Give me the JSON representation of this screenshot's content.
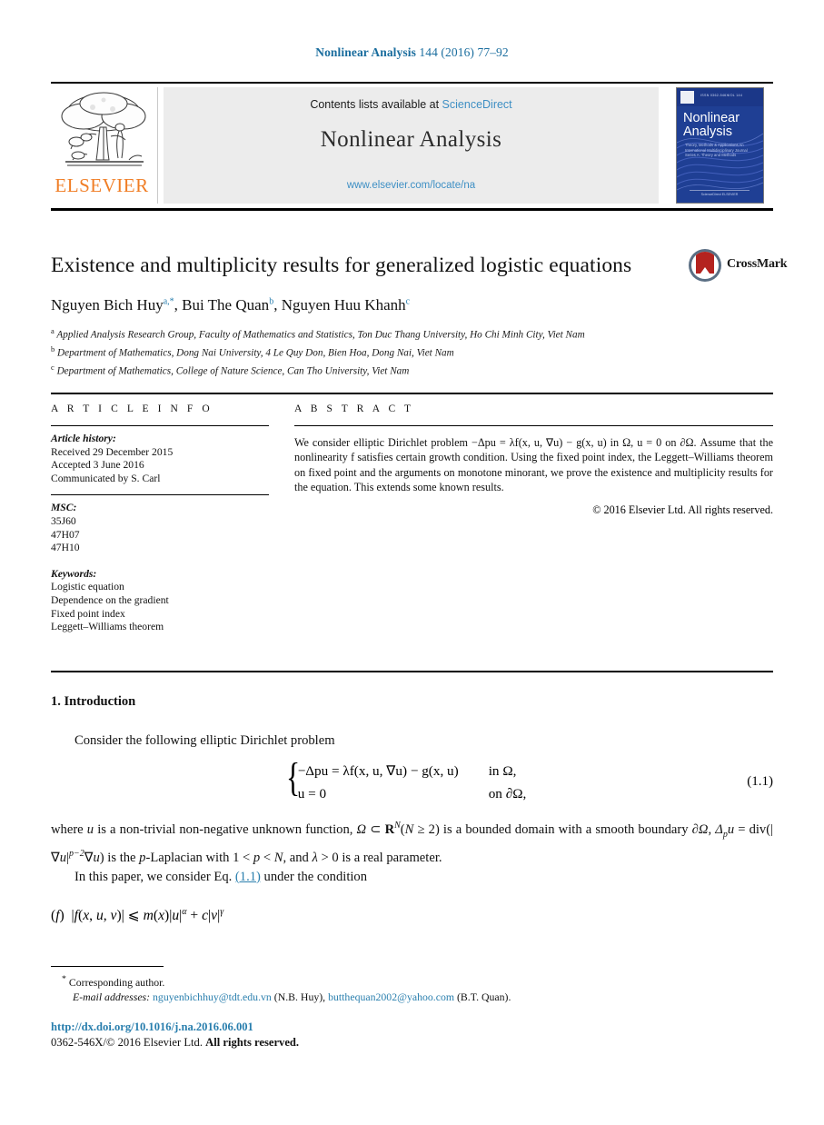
{
  "running_head": {
    "journal": "Nonlinear Analysis",
    "volume_info": " 144 (2016) 77–92"
  },
  "masthead": {
    "contents_prefix": "Contents lists available at ",
    "sciencedirect": "ScienceDirect",
    "journal_name": "Nonlinear Analysis",
    "url": "www.elsevier.com/locate/na",
    "publisher_word": "ELSEVIER",
    "cover": {
      "title_line1": "Nonlinear",
      "title_line2": "Analysis",
      "subtitle": "Theory, Methods & Applications\nAn International Multidisciplinary Journal\nSeries A: Theory and Methods",
      "footer": "ScienceDirect\nELSEVIER"
    }
  },
  "article": {
    "title": "Existence and multiplicity results for generalized logistic equations",
    "crossmark_label": "CrossMark",
    "authors_html": "Nguyen Bich Huy<sup>a,*</sup>, Bui The Quan<sup>b</sup>, Nguyen Huu Khanh<sup>c</sup>",
    "authors_plain": "Nguyen Bich Huy, Bui The Quan, Nguyen Huu Khanh",
    "affiliations": [
      "Applied Analysis Research Group, Faculty of Mathematics and Statistics, Ton Duc Thang University, Ho Chi Minh City, Viet Nam",
      "Department of Mathematics, Dong Nai University, 4 Le Quy Don, Bien Hoa, Dong Nai, Viet Nam",
      "Department of Mathematics, College of Nature Science, Can Tho University, Viet Nam"
    ],
    "affiliation_marks": [
      "a",
      "b",
      "c"
    ]
  },
  "article_info": {
    "heading": "A R T I C L E  I N F O",
    "history_label": "Article history:",
    "history": [
      "Received 29 December 2015",
      "Accepted 3 June 2016",
      "Communicated by S. Carl"
    ],
    "msc_label": "MSC:",
    "msc": [
      "35J60",
      "47H07",
      "47H10"
    ],
    "keywords_label": "Keywords:",
    "keywords": [
      "Logistic equation",
      "Dependence on the gradient",
      "Fixed point index",
      "Leggett–Williams theorem"
    ]
  },
  "abstract": {
    "heading": "A B S T R A C T",
    "text": "We consider elliptic Dirichlet problem −Δpu = λf(x, u, ∇u) − g(x, u) in Ω, u = 0 on ∂Ω. Assume that the nonlinearity f satisfies certain growth condition. Using the fixed point index, the Leggett–Williams theorem on fixed point and the arguments on monotone minorant, we prove the existence and multiplicity results for the equation. This extends some known results.",
    "copyright": "© 2016 Elsevier Ltd. All rights reserved."
  },
  "body": {
    "section_number_title": "1. Introduction",
    "consider_line": "Consider the following elliptic Dirichlet problem",
    "equation": {
      "line1_lhs": "−Δpu = λf(x, u, ∇u) − g(x, u)",
      "line1_cond": "in Ω,",
      "line2_lhs": "u = 0",
      "line2_cond": "on ∂Ω,",
      "number": "(1.1)"
    },
    "paragraph_where": "where u is a non-trivial non-negative unknown function, Ω ⊂ R^N(N ≥ 2) is a bounded domain with a smooth boundary ∂Ω, Δpu = div(|∇u|^{p−2}∇u) is the p-Laplacian with 1 < p < N, and λ > 0 is a real parameter.",
    "paragraph_inthis_pre": "In this paper, we consider Eq. ",
    "paragraph_inthis_ref": "(1.1)",
    "paragraph_inthis_post": " under the condition",
    "condition_f": "(f)  |f(x, u, v)| ⩽ m(x)|u|^α + c|v|^γ"
  },
  "footnotes": {
    "corresponding": "Corresponding author.",
    "emails_label": "E-mail addresses:",
    "email1": "nguyenbichhuy@tdt.edu.vn",
    "email1_owner": "(N.B. Huy),",
    "email2": "butthequan2002@yahoo.com",
    "email2_owner": "(B.T. Quan)."
  },
  "footer": {
    "doi": "http://dx.doi.org/10.1016/j.na.2016.06.001",
    "issn_prefix": "0362-546X/© 2016 Elsevier Ltd. ",
    "issn_rights": "All rights reserved."
  },
  "colors": {
    "link_blue": "#2a7fae",
    "header_blue": "#1a6d9e",
    "elsevier_orange": "#f07e26",
    "cover_blue": "#1f3f94",
    "crossmark_red": "#b4231f",
    "masthead_gray": "#ececec"
  }
}
